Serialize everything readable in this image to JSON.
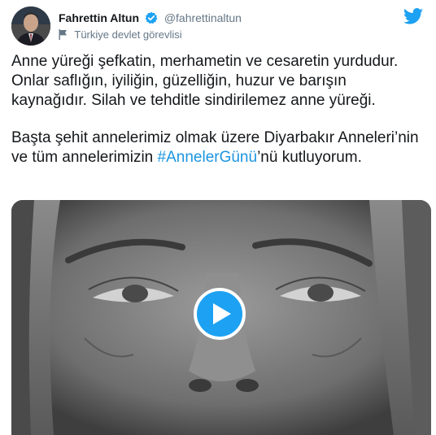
{
  "author": {
    "display_name": "Fahrettin Altun",
    "handle": "@fahrettinaltun",
    "label": "Türkiye devlet görevlisi",
    "avatar_icon": "profile-photo",
    "verified_icon": "verified-badge-icon"
  },
  "brand": {
    "icon": "twitter-bird-icon",
    "color": "#1da1f2"
  },
  "tweet": {
    "line1": "Anne yüreği şefkatin, merhametin ve cesaretin yurdudur. Onlar saflığın, iyiliğin, güzelliğin, huzur ve barışın kaynağıdır. Silah ve tehditle sindirilemez anne yüreği.",
    "line2_before": "Başta şehit annelerimiz olmak üzere Diyarbakır Anneleri’nin ve tüm annelerimizin ",
    "hashtag": "#AnnelerGünü",
    "line2_after": "’nü kutluyorum.",
    "hashtag_color": "#1b95e0"
  },
  "media": {
    "type": "video",
    "play_icon": "play-icon",
    "accent": "#1da1f2"
  }
}
